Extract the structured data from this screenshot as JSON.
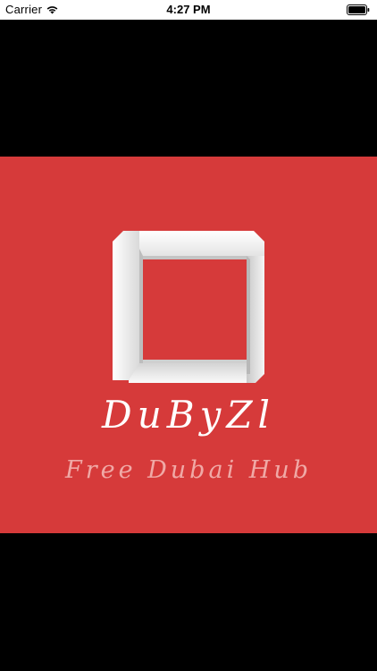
{
  "status_bar": {
    "carrier": "Carrier",
    "time": "4:27 PM",
    "icons": [
      "wifi-icon",
      "battery-icon"
    ]
  },
  "splash": {
    "logo_icon": "impossible-square-logo-icon",
    "title": "DuByZl",
    "tagline": "Free Dubai Hub"
  },
  "colors": {
    "background": "#000000",
    "splash_red": "#d63a3a",
    "title_text": "#ffffff",
    "tagline_text": "#f0a9a6",
    "status_bar_bg": "#ffffff"
  }
}
